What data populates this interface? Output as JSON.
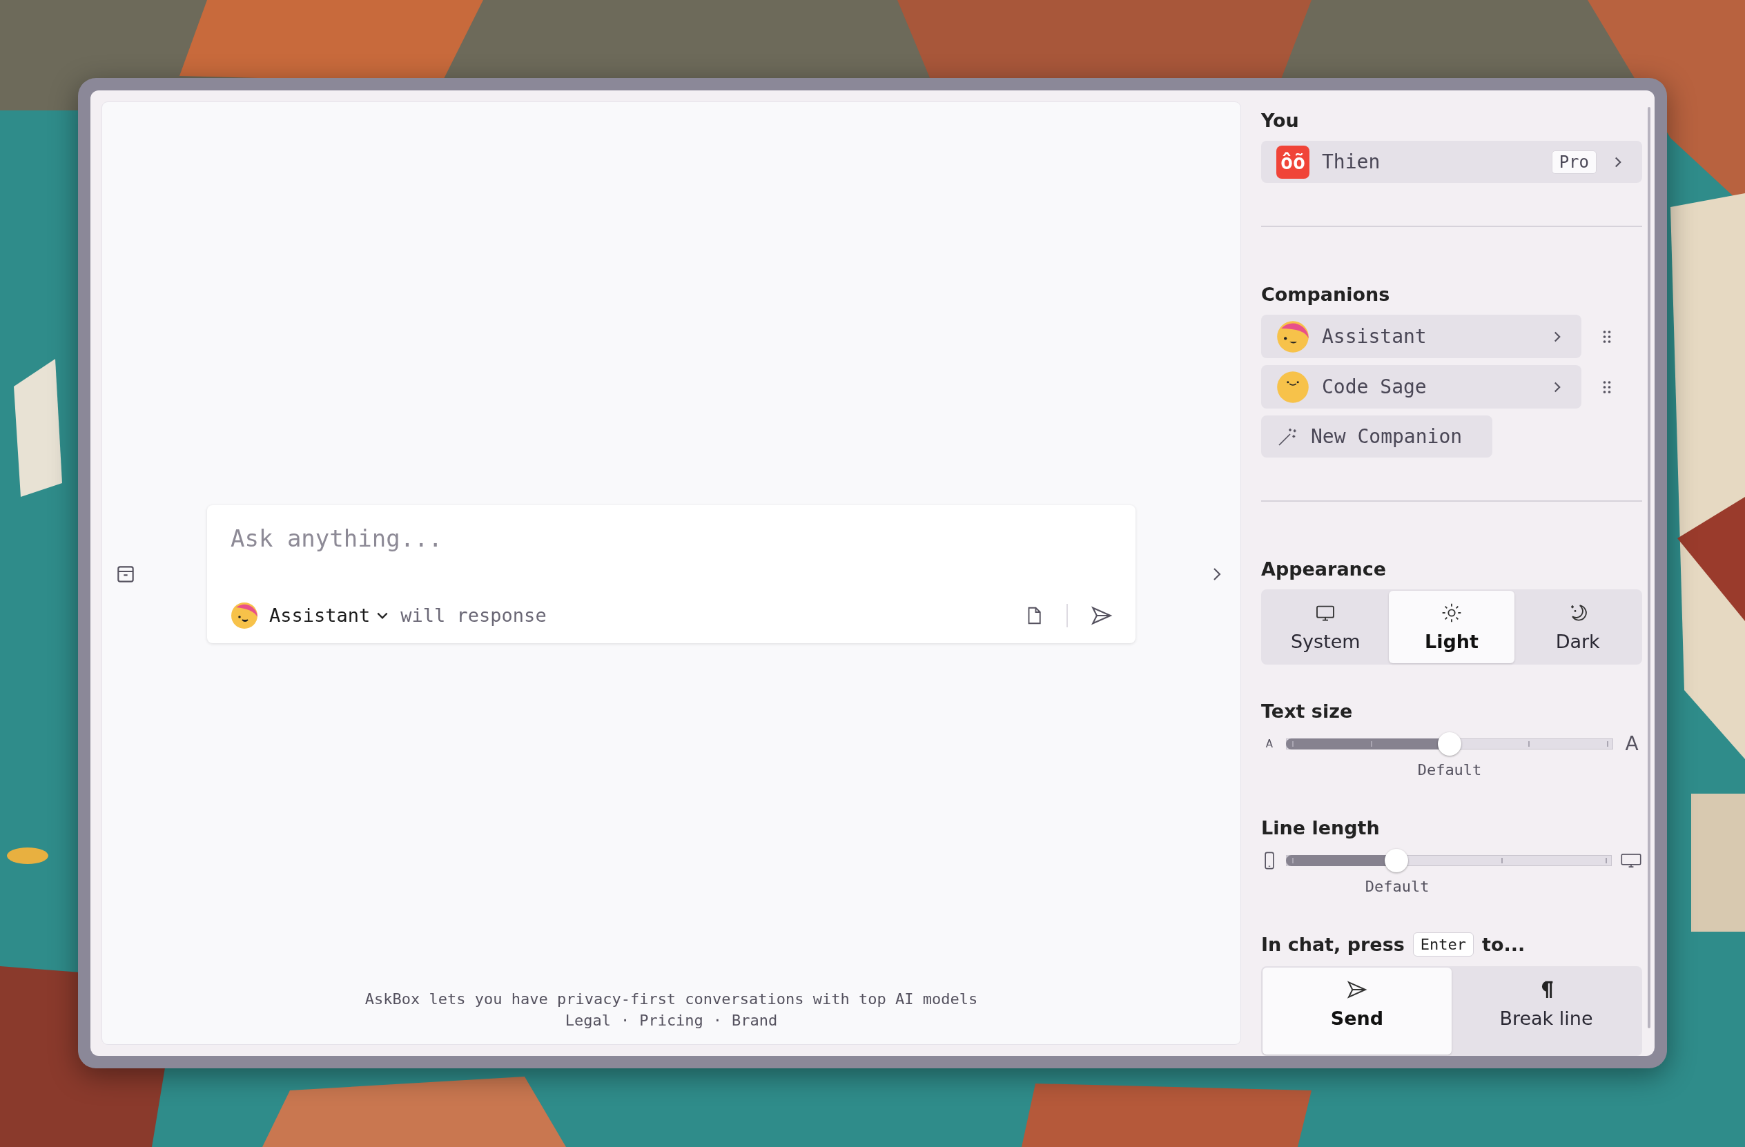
{
  "chat": {
    "input": {
      "placeholder": "Ask anything..."
    },
    "companion": "Assistant",
    "suffix": "will response",
    "footer": {
      "text": "AskBox lets you have privacy-first conversations with top AI models",
      "links": [
        "Legal",
        "Pricing",
        "Brand"
      ],
      "separator": "·"
    }
  },
  "sidebar": {
    "you": {
      "heading": "You",
      "avatar_text": "ôõ",
      "name": "Thien",
      "badge": "Pro"
    },
    "companions": {
      "heading": "Companions",
      "items": [
        {
          "name": "Assistant"
        },
        {
          "name": "Code Sage"
        }
      ],
      "new_button": "New Companion"
    },
    "appearance": {
      "heading": "Appearance",
      "options": [
        {
          "label": "System",
          "selected": false
        },
        {
          "label": "Light",
          "selected": true
        },
        {
          "label": "Dark",
          "selected": false
        }
      ]
    },
    "text_size": {
      "heading": "Text size",
      "small_label": "A",
      "large_label": "A",
      "level": 0.5,
      "reading": "Default"
    },
    "line_length": {
      "heading": "Line length",
      "level": 0.34,
      "reading": "Default"
    },
    "enter": {
      "heading": "In chat, press",
      "key": "Enter",
      "heading_end": "to...",
      "options": [
        {
          "label": "Send",
          "selected": true
        },
        {
          "label": "Break line",
          "selected": false
        }
      ]
    }
  }
}
